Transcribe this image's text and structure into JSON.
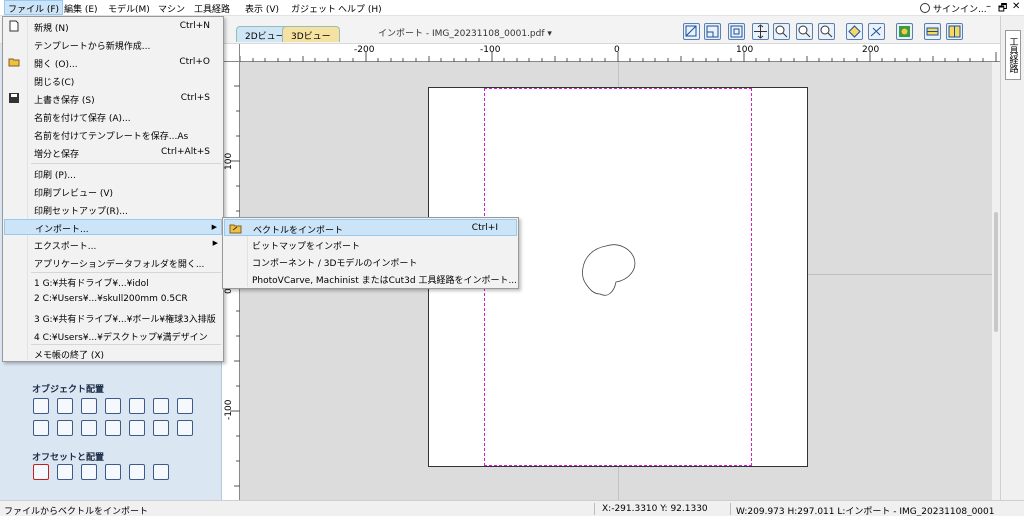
{
  "menubar": {
    "items": [
      "ファイル (F)",
      "編集 (E)",
      "モデル(M)",
      "マシン",
      "工具経路",
      "表示 (V)",
      "ガジェット",
      "ヘルプ (H)"
    ],
    "account": "サインイン...",
    "minimize": "–",
    "restore": "🗗",
    "close": "✕"
  },
  "toolbar": {
    "tab_2d": "2Dビュー",
    "tab_3d": "3Dビュー",
    "file_title": "インポート - IMG_20231108_0001.pdf ▾"
  },
  "right_panel": {
    "tab_label": "工具経路"
  },
  "ruler": {
    "top_labels": [
      "-200",
      "-100",
      "0",
      "100",
      "200"
    ],
    "left_labels": [
      "100",
      "0",
      "-100"
    ]
  },
  "left_panel": {
    "object_align_heading": "オブジェクト配置",
    "offset_heading": "オフセットと配置"
  },
  "file_menu": {
    "items": [
      {
        "label": "新規 (N)",
        "shortcut": "Ctrl+N"
      },
      {
        "label": "テンプレートから新規作成...",
        "shortcut": ""
      },
      {
        "label": "開く (O)...",
        "shortcut": "Ctrl+O"
      },
      {
        "label": "閉じる(C)",
        "shortcut": ""
      },
      {
        "label": "上書き保存 (S)",
        "shortcut": "Ctrl+S"
      },
      {
        "label": "名前を付けて保存 (A)...",
        "shortcut": ""
      },
      {
        "label": "名前を付けてテンプレートを保存...As",
        "shortcut": ""
      },
      {
        "label": "増分と保存",
        "shortcut": "Ctrl+Alt+S"
      },
      {
        "label": "印刷 (P)...",
        "shortcut": ""
      },
      {
        "label": "印刷プレビュー (V)",
        "shortcut": ""
      },
      {
        "label": "印刷セットアップ(R)...",
        "shortcut": ""
      },
      {
        "label": "インポート...",
        "shortcut": ""
      },
      {
        "label": "エクスポート...",
        "shortcut": ""
      },
      {
        "label": "アプリケーションデータフォルダを開く...",
        "shortcut": ""
      },
      {
        "label": "1 G:¥共有ドライブ¥...¥idol",
        "shortcut": ""
      },
      {
        "label": "2 C:¥Users¥...¥skull200mm 0.5CR",
        "shortcut": ""
      },
      {
        "label": "3 G:¥共有ドライブ¥...¥ボール¥権球3入排版",
        "shortcut": ""
      },
      {
        "label": "4 C:¥Users¥...¥デスクトップ¥満デザイン",
        "shortcut": ""
      },
      {
        "label": "メモ帳の終了 (X)",
        "shortcut": ""
      }
    ]
  },
  "import_submenu": {
    "items": [
      {
        "label": "ベクトルをインポート",
        "shortcut": "Ctrl+I"
      },
      {
        "label": "ビットマップをインポート",
        "shortcut": ""
      },
      {
        "label": "コンポーネント / 3Dモデルのインポート",
        "shortcut": ""
      },
      {
        "label": "PhotoVCarve, Machinist またはCut3d 工具経路をインポート...",
        "shortcut": ""
      }
    ]
  },
  "status": {
    "hint": "ファイルからベクトルをインポート",
    "coords": "X:-291.3310 Y: 92.1330",
    "dims": "W:209.973  H:297.011  L:インポート - IMG_20231108_0001"
  }
}
